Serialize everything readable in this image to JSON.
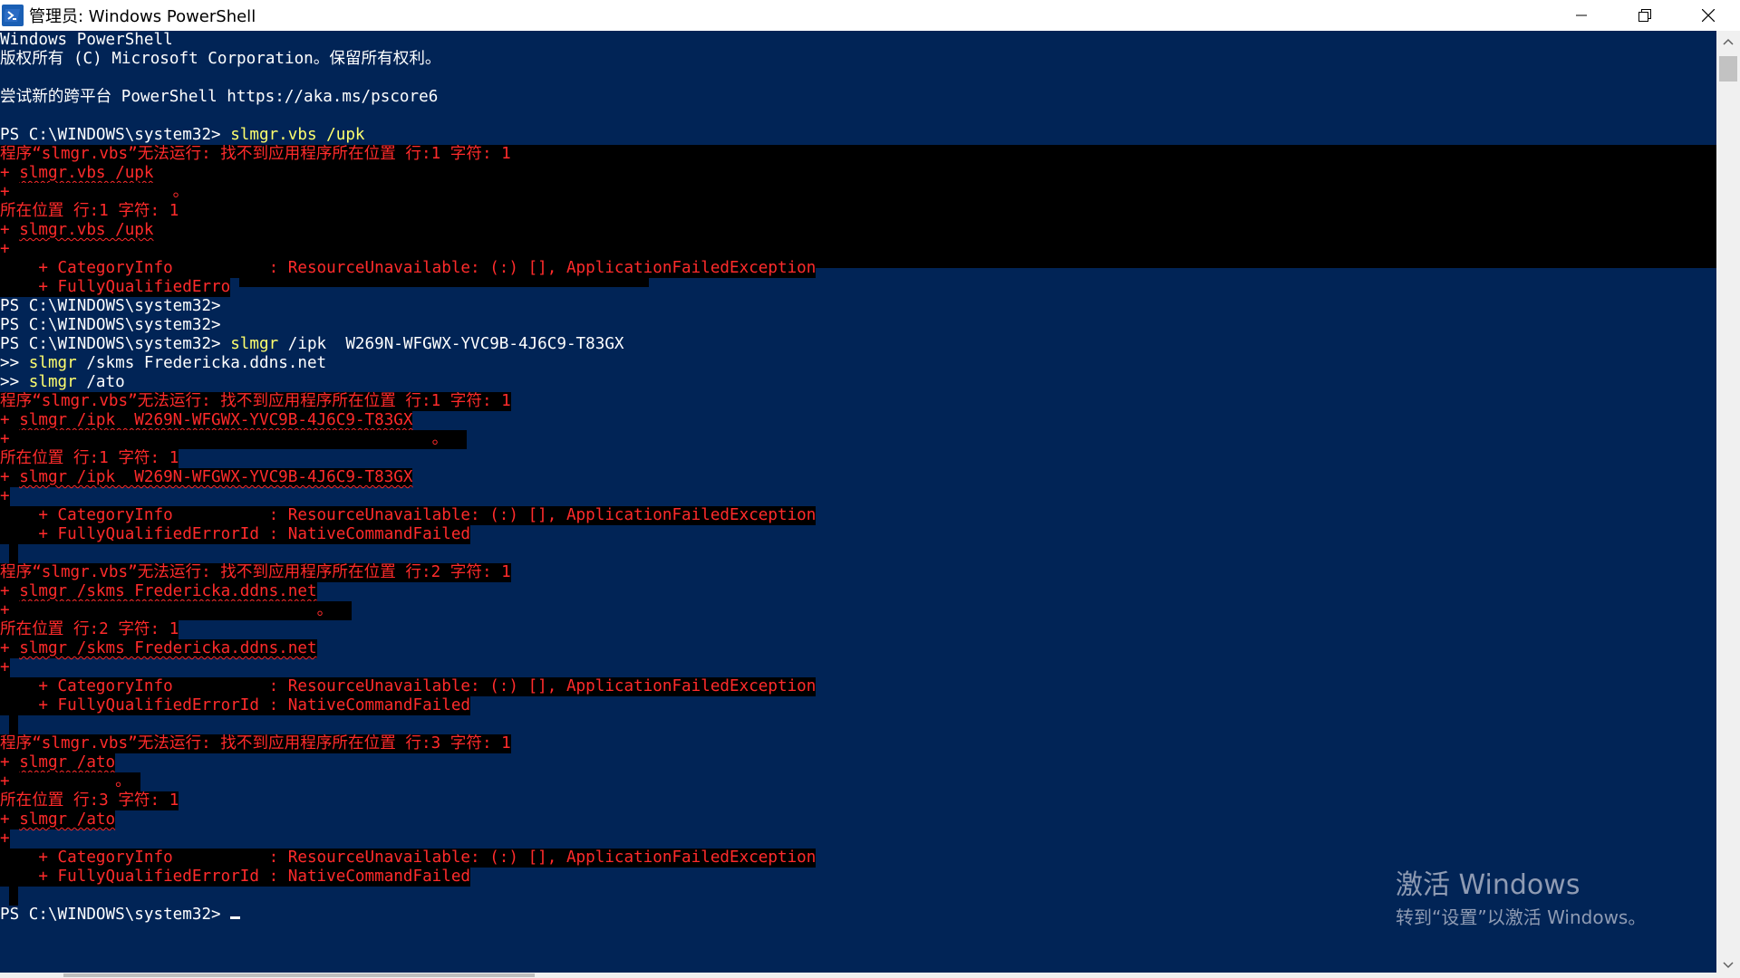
{
  "window": {
    "title": "管理员: Windows PowerShell",
    "controls": [
      "minimize",
      "restore",
      "close"
    ]
  },
  "console": {
    "header": [
      "Windows PowerShell",
      "版权所有 (C) Microsoft Corporation。保留所有权利。",
      "",
      "尝试新的跨平台 PowerShell https://aka.ms/pscore6"
    ],
    "prompt": "PS C:\\WINDOWS\\system32> ",
    "continuation_prompt": ">> ",
    "cmd1": "slmgr.vbs /upk",
    "cmd2_a": "slmgr",
    "cmd2_b": " /ipk  W269N-WFGWX-YVC9B-4J6C9-T83GX",
    "cmd3_a": "slmgr",
    "cmd3_b": " /skms Fredericka.ddns.net",
    "cmd4_a": "slmgr",
    "cmd4_b": " /ato",
    "errors": {
      "e1_msg": "程序“slmgr.vbs”无法运行: 找不到应用程序所在位置 行:1 字符: 1",
      "e1_cmd": "slmgr.vbs /upk",
      "plus": "+",
      "dot": "。",
      "e1_loc": "所在位置 行:1 字符: 1",
      "cat": "    + CategoryInfo          : ResourceUnavailable: (:) [], ApplicationFailedException",
      "fq_trunc": "    + FullyQualifiedErro",
      "fq": "    + FullyQualifiedErrorId : NativeCommandFailed",
      "e2_msg": "程序“slmgr.vbs”无法运行: 找不到应用程序所在位置 行:1 字符: 1",
      "e2_cmd": "slmgr /ipk  W269N-WFGWX-YVC9B-4J6C9-T83GX",
      "e2_loc": "所在位置 行:1 字符: 1",
      "e3_msg": "程序“slmgr.vbs”无法运行: 找不到应用程序所在位置 行:2 字符: 1",
      "e3_cmd": "slmgr /skms Fredericka.ddns.net",
      "e3_loc": "所在位置 行:2 字符: 1",
      "e4_msg": "程序“slmgr.vbs”无法运行: 找不到应用程序所在位置 行:3 字符: 1",
      "e4_cmd": "slmgr /ato",
      "e4_loc": "所在位置 行:3 字符: 1"
    }
  },
  "activation_watermark": {
    "line1": "激活 Windows",
    "line2": "转到“设置”以激活 Windows。"
  },
  "colors": {
    "console_bg": "#012456",
    "error_fg": "#ff2b2b",
    "command_fg": "#ffff6e"
  }
}
